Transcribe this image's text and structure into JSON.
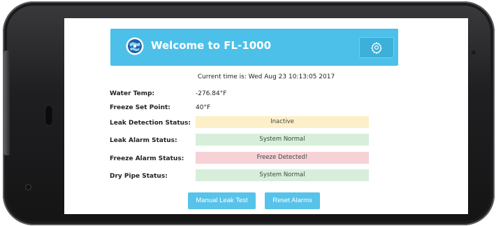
{
  "app": {
    "title": "Welcome to FL-1000",
    "settings_icon": "gear-icon",
    "logo_icon": "globe-logo-icon"
  },
  "time": {
    "text": "Current time is: Wed Aug 23 10:13:05 2017"
  },
  "readings": [
    {
      "label": "Water Temp:",
      "value": "-276.84°F"
    },
    {
      "label": "Freeze Set Point:",
      "value": "40°F"
    }
  ],
  "statuses": [
    {
      "label": "Leak Detection Status:",
      "value": "Inactive",
      "color": "#fdf0c9"
    },
    {
      "label": "Leak Alarm Status:",
      "value": "System Normal",
      "color": "#d7efda"
    },
    {
      "label": "Freeze Alarm Status:",
      "value": "Freeze Detected!",
      "color": "#f6d1d6"
    },
    {
      "label": "Dry Pipe Status:",
      "value": "System Normal",
      "color": "#d7efda"
    }
  ],
  "actions": {
    "manual_leak_test": "Manual Leak Test",
    "reset_alarms": "Reset Alarms"
  },
  "colors": {
    "header": "#4cc0e8",
    "button": "#57c3ea"
  }
}
